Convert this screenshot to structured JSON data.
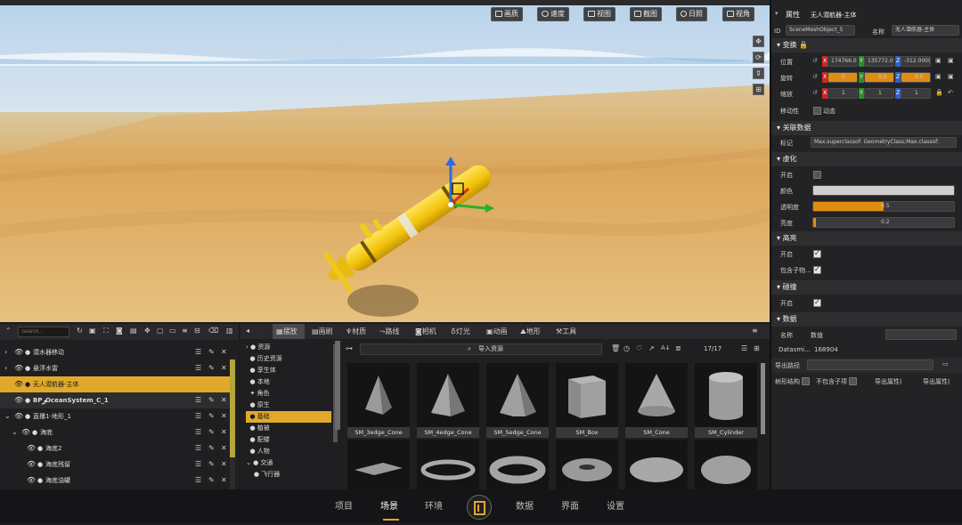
{
  "viewport": {
    "buttons": [
      {
        "label": "画质",
        "icon": "image-icon"
      },
      {
        "label": "速度",
        "icon": "speed-icon"
      },
      {
        "label": "视图",
        "icon": "view-icon"
      },
      {
        "label": "截图",
        "icon": "screenshot-icon"
      },
      {
        "label": "日照",
        "icon": "sun-icon"
      },
      {
        "label": "视角",
        "icon": "eye-icon"
      }
    ]
  },
  "properties": {
    "header": "属性",
    "header_object": "无人潜航器-主体",
    "id_label": "ID",
    "id_value": "SceneMeshObject_5",
    "name_label": "名称",
    "name_value": "无人潜航器-主体",
    "transform": {
      "title": "变换",
      "position_label": "位置",
      "position": [
        "174766.0",
        "135772.0",
        "-312.000("
      ],
      "rotation_label": "旋转",
      "rotation": [
        "0",
        "0.0",
        "0.0"
      ],
      "scale_label": "缩放",
      "scale": [
        "1",
        "1",
        "1"
      ],
      "mobility_label": "移动性",
      "mobility_value": "动态",
      "axes": [
        "X",
        "Y",
        "Z"
      ]
    },
    "linked": {
      "title": "关联数据",
      "tag_label": "标记",
      "tag_value": "Max.superclassof: GeometryClass;Max.classof:"
    },
    "virtual": {
      "title": "虚化",
      "enable_label": "开启",
      "color_label": "颜色",
      "opacity_label": "透明度",
      "opacity_value": "0.5",
      "opacity_fraction": 0.5,
      "brightness_label": "亮度",
      "brightness_value": "0.2",
      "brightness_fraction": 0.02
    },
    "highlight": {
      "title": "高亮",
      "enable_label": "开启",
      "include_children_label": "包含子物..."
    },
    "collision": {
      "title": "碰撞",
      "enable_label": "开启"
    },
    "data": {
      "title": "数据",
      "name_label": "名称",
      "name_value": "数值",
      "datasmith_label": "Datasmi...",
      "datasmith_value": "168904",
      "export_path_label": "导出路径",
      "tree_label": "树形结构",
      "exclude_children_label": "不包含子项",
      "export_btn1": "导出属性(",
      "export_btn2": "导出属性("
    }
  },
  "outliner": {
    "search_placeholder": "Search...",
    "rows": [
      {
        "label": "潜水器移动"
      },
      {
        "label": "悬浮水雷"
      },
      {
        "label": "无人潜航器-主体"
      },
      {
        "label": "BP_OceanSystem_C_1"
      },
      {
        "label": "直播1-地形_1"
      },
      {
        "label": "海底"
      },
      {
        "label": "海底2"
      },
      {
        "label": "海底残留"
      },
      {
        "label": "海底油罐"
      }
    ]
  },
  "assets": {
    "tabs": [
      "摆放",
      "画刷",
      "材质",
      "路线",
      "相机",
      "灯光",
      "动画",
      "地形",
      "工具"
    ],
    "search_label": "导入资源",
    "count": "17/17",
    "tree": [
      "资源",
      "历史资源",
      "孪生体",
      "本地",
      "角色",
      "原生",
      "基础",
      "植被",
      "配楼",
      "人物",
      "交通",
      "飞行器"
    ],
    "tiles": [
      "SM_3edge_Cone",
      "SM_4edge_Cone",
      "SM_5edge_Cone",
      "SM_Box",
      "SM_Cone",
      "SM_Cylinder"
    ]
  },
  "bottom_nav": [
    "项目",
    "场景",
    "环境",
    "数据",
    "界面",
    "设置"
  ]
}
